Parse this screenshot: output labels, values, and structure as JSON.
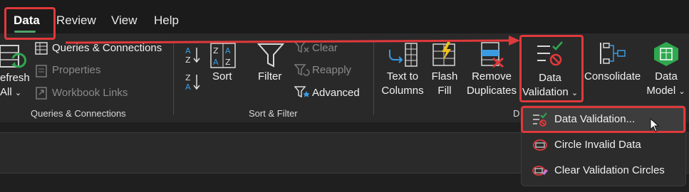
{
  "tabs": [
    {
      "label": "Data",
      "active": true
    },
    {
      "label": "Review"
    },
    {
      "label": "View"
    },
    {
      "label": "Help"
    }
  ],
  "groups": {
    "queries": {
      "title": "Queries & Connections",
      "refresh_line1": "efresh",
      "refresh_line2": "All",
      "items": [
        "Queries & Connections",
        "Properties",
        "Workbook Links"
      ]
    },
    "sort_filter": {
      "title": "Sort & Filter",
      "sort": "Sort",
      "filter": "Filter",
      "clear": "Clear",
      "reapply": "Reapply",
      "advanced": "Advanced"
    },
    "data_tools": {
      "title_fragment": "D",
      "text_to_columns": [
        "Text to",
        "Columns"
      ],
      "flash_fill": [
        "Flash",
        "Fill"
      ],
      "remove_duplicates": [
        "Remove",
        "Duplicates"
      ],
      "data_validation": [
        "Data",
        "Validation"
      ],
      "consolidate": "Consolidate",
      "data_model": [
        "Data",
        "Model"
      ]
    }
  },
  "dropdown": {
    "items": [
      "Data Validation...",
      "Circle Invalid Data",
      "Clear Validation Circles"
    ]
  },
  "colors": {
    "highlight": "#e0393b",
    "accent_green": "#4fa36b",
    "icon_blue": "#3a9be0",
    "icon_red": "#e0393b",
    "icon_green": "#2fa84f"
  }
}
